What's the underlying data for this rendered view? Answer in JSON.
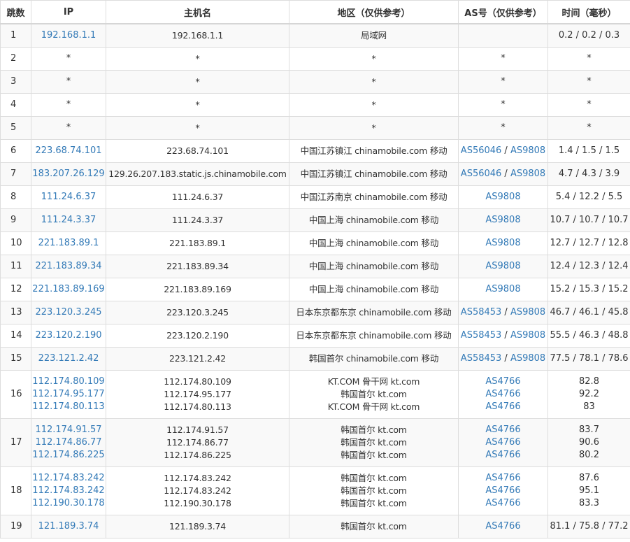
{
  "headers": {
    "hop": "跳数",
    "ip": "IP",
    "host": "主机名",
    "location": "地区（仅供参考）",
    "as": "AS号（仅供参考）",
    "time": "时间（毫秒）"
  },
  "rows": [
    {
      "hop": "1",
      "lines": [
        {
          "ip": "192.168.1.1",
          "host": "192.168.1.1",
          "location": "局域网",
          "as": [],
          "time": "0.2 / 0.2 / 0.3"
        }
      ]
    },
    {
      "hop": "2",
      "lines": [
        {
          "ip": "*",
          "host": "*",
          "location": "*",
          "as": [
            "*"
          ],
          "time": "*"
        }
      ]
    },
    {
      "hop": "3",
      "lines": [
        {
          "ip": "*",
          "host": "*",
          "location": "*",
          "as": [
            "*"
          ],
          "time": "*"
        }
      ]
    },
    {
      "hop": "4",
      "lines": [
        {
          "ip": "*",
          "host": "*",
          "location": "*",
          "as": [
            "*"
          ],
          "time": "*"
        }
      ]
    },
    {
      "hop": "5",
      "lines": [
        {
          "ip": "*",
          "host": "*",
          "location": "*",
          "as": [
            "*"
          ],
          "time": "*"
        }
      ]
    },
    {
      "hop": "6",
      "lines": [
        {
          "ip": "223.68.74.101",
          "host": "223.68.74.101",
          "location": "中国江苏镇江 chinamobile.com 移动",
          "as": [
            "AS56046",
            "AS9808"
          ],
          "time": "1.4 / 1.5 / 1.5"
        }
      ]
    },
    {
      "hop": "7",
      "lines": [
        {
          "ip": "183.207.26.129",
          "host": "129.26.207.183.static.js.chinamobile.com",
          "location": "中国江苏镇江 chinamobile.com 移动",
          "as": [
            "AS56046",
            "AS9808"
          ],
          "time": "4.7 / 4.3 / 3.9"
        }
      ]
    },
    {
      "hop": "8",
      "lines": [
        {
          "ip": "111.24.6.37",
          "host": "111.24.6.37",
          "location": "中国江苏南京 chinamobile.com 移动",
          "as": [
            "AS9808"
          ],
          "time": "5.4 / 12.2 / 5.5"
        }
      ]
    },
    {
      "hop": "9",
      "lines": [
        {
          "ip": "111.24.3.37",
          "host": "111.24.3.37",
          "location": "中国上海 chinamobile.com 移动",
          "as": [
            "AS9808"
          ],
          "time": "10.7 / 10.7 / 10.7"
        }
      ]
    },
    {
      "hop": "10",
      "lines": [
        {
          "ip": "221.183.89.1",
          "host": "221.183.89.1",
          "location": "中国上海 chinamobile.com 移动",
          "as": [
            "AS9808"
          ],
          "time": "12.7 / 12.7 / 12.8"
        }
      ]
    },
    {
      "hop": "11",
      "lines": [
        {
          "ip": "221.183.89.34",
          "host": "221.183.89.34",
          "location": "中国上海 chinamobile.com 移动",
          "as": [
            "AS9808"
          ],
          "time": "12.4 / 12.3 / 12.4"
        }
      ]
    },
    {
      "hop": "12",
      "lines": [
        {
          "ip": "221.183.89.169",
          "host": "221.183.89.169",
          "location": "中国上海 chinamobile.com 移动",
          "as": [
            "AS9808"
          ],
          "time": "15.2 / 15.3 / 15.2"
        }
      ]
    },
    {
      "hop": "13",
      "lines": [
        {
          "ip": "223.120.3.245",
          "host": "223.120.3.245",
          "location": "日本东京都东京 chinamobile.com 移动",
          "as": [
            "AS58453",
            "AS9808"
          ],
          "time": "46.7 / 46.1 / 45.8"
        }
      ]
    },
    {
      "hop": "14",
      "lines": [
        {
          "ip": "223.120.2.190",
          "host": "223.120.2.190",
          "location": "日本东京都东京 chinamobile.com 移动",
          "as": [
            "AS58453",
            "AS9808"
          ],
          "time": "55.5 / 46.3 / 48.8"
        }
      ]
    },
    {
      "hop": "15",
      "lines": [
        {
          "ip": "223.121.2.42",
          "host": "223.121.2.42",
          "location": "韩国首尔 chinamobile.com 移动",
          "as": [
            "AS58453",
            "AS9808"
          ],
          "time": "77.5 / 78.1 / 78.6"
        }
      ]
    },
    {
      "hop": "16",
      "lines": [
        {
          "ip": "112.174.80.109",
          "host": "112.174.80.109",
          "location": "KT.COM 骨干网 kt.com",
          "as": [
            "AS4766"
          ],
          "time": "82.8"
        },
        {
          "ip": "112.174.95.177",
          "host": "112.174.95.177",
          "location": "韩国首尔 kt.com",
          "as": [
            "AS4766"
          ],
          "time": "92.2"
        },
        {
          "ip": "112.174.80.113",
          "host": "112.174.80.113",
          "location": "KT.COM 骨干网 kt.com",
          "as": [
            "AS4766"
          ],
          "time": "83"
        }
      ]
    },
    {
      "hop": "17",
      "lines": [
        {
          "ip": "112.174.91.57",
          "host": "112.174.91.57",
          "location": "韩国首尔 kt.com",
          "as": [
            "AS4766"
          ],
          "time": "83.7"
        },
        {
          "ip": "112.174.86.77",
          "host": "112.174.86.77",
          "location": "韩国首尔 kt.com",
          "as": [
            "AS4766"
          ],
          "time": "90.6"
        },
        {
          "ip": "112.174.86.225",
          "host": "112.174.86.225",
          "location": "韩国首尔 kt.com",
          "as": [
            "AS4766"
          ],
          "time": "80.2"
        }
      ]
    },
    {
      "hop": "18",
      "lines": [
        {
          "ip": "112.174.83.242",
          "host": "112.174.83.242",
          "location": "韩国首尔 kt.com",
          "as": [
            "AS4766"
          ],
          "time": "87.6"
        },
        {
          "ip": "112.174.83.242",
          "host": "112.174.83.242",
          "location": "韩国首尔 kt.com",
          "as": [
            "AS4766"
          ],
          "time": "95.1"
        },
        {
          "ip": "112.190.30.178",
          "host": "112.190.30.178",
          "location": "韩国首尔 kt.com",
          "as": [
            "AS4766"
          ],
          "time": "83.3"
        }
      ]
    },
    {
      "hop": "19",
      "lines": [
        {
          "ip": "121.189.3.74",
          "host": "121.189.3.74",
          "location": "韩国首尔 kt.com",
          "as": [
            "AS4766"
          ],
          "time": "81.1 / 75.8 / 77.2"
        }
      ]
    }
  ],
  "colors": {
    "link": "#337ab7",
    "text": "#333333",
    "border": "#dddddd",
    "stripe": "#f9f9f9"
  }
}
